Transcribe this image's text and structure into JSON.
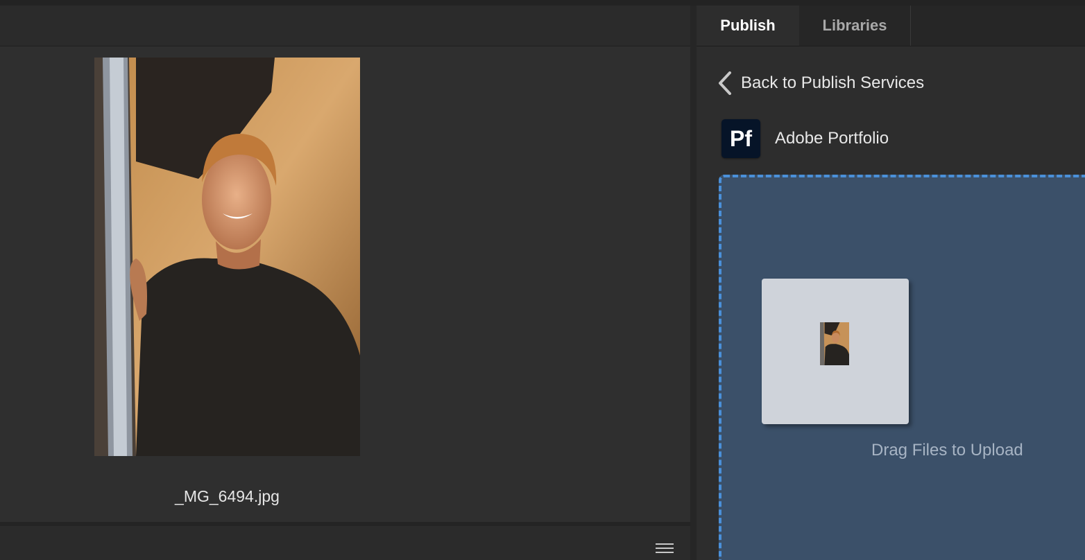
{
  "photo": {
    "filename": "_MG_6494.jpg"
  },
  "tabs": [
    {
      "label": "Publish",
      "active": true
    },
    {
      "label": "Libraries",
      "active": false
    }
  ],
  "back_link": {
    "label": "Back to Publish Services",
    "icon": "chevron-left-icon"
  },
  "service": {
    "logo_text": "Pf",
    "name": "Adobe Portfolio"
  },
  "drop_zone": {
    "label": "Drag Files to Upload"
  },
  "bottom_bar": {
    "icon": "hamburger-menu-icon"
  },
  "colors": {
    "accent": "#4a90d9",
    "drop_zone_bg": "#3b5069",
    "panel_bg": "#2f2f2f",
    "logo_bg": "#061428"
  }
}
